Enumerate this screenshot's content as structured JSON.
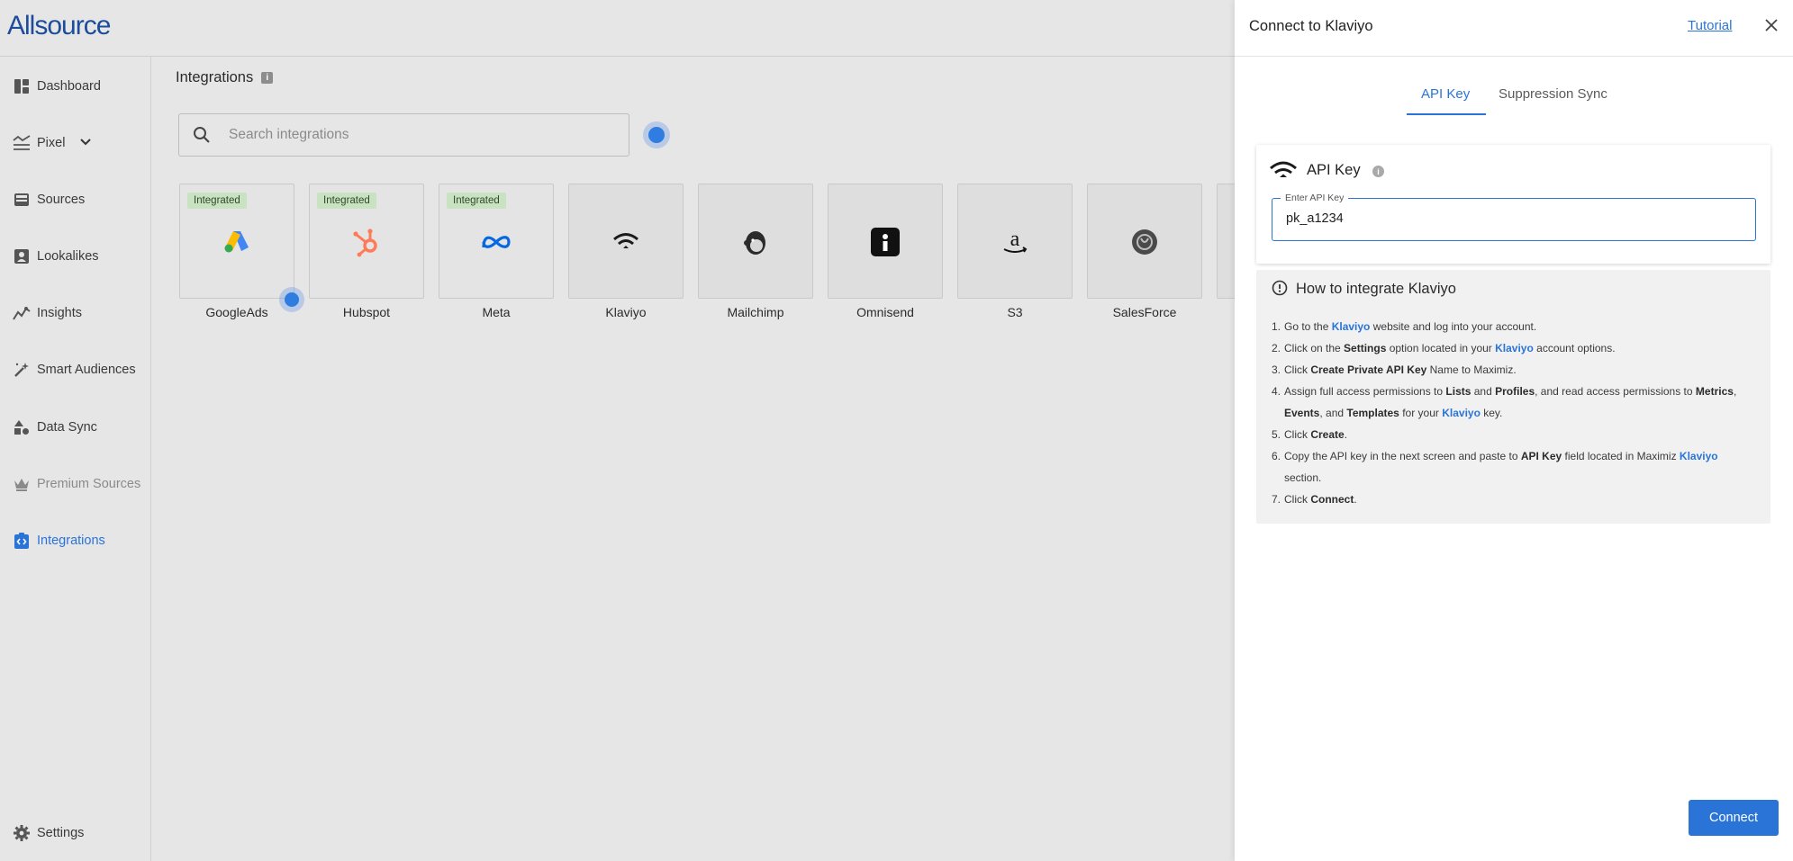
{
  "app": {
    "logo_text": "Allsource"
  },
  "sidebar": {
    "items": [
      {
        "label": "Dashboard",
        "icon": "dashboard-icon"
      },
      {
        "label": "Pixel",
        "icon": "pixel-icon"
      },
      {
        "label": "Sources",
        "icon": "sources-icon"
      },
      {
        "label": "Lookalikes",
        "icon": "lookalikes-icon"
      },
      {
        "label": "Insights",
        "icon": "insights-icon"
      },
      {
        "label": "Smart Audiences",
        "icon": "magic-wand-icon"
      },
      {
        "label": "Data Sync",
        "icon": "data-sync-icon"
      },
      {
        "label": "Premium Sources",
        "icon": "crown-icon"
      },
      {
        "label": "Integrations",
        "icon": "integrations-icon",
        "active": true
      },
      {
        "label": "Settings",
        "icon": "gear-icon"
      }
    ]
  },
  "main": {
    "title": "Integrations",
    "search_placeholder": "Search integrations",
    "integrations": [
      {
        "name": "GoogleAds",
        "badge": "Integrated"
      },
      {
        "name": "Hubspot",
        "badge": "Integrated"
      },
      {
        "name": "Meta",
        "badge": "Integrated"
      },
      {
        "name": "Klaviyo"
      },
      {
        "name": "Mailchimp"
      },
      {
        "name": "Omnisend"
      },
      {
        "name": "S3"
      },
      {
        "name": "SalesForce"
      }
    ]
  },
  "drawer": {
    "title": "Connect to Klaviyo",
    "tutorial_label": "Tutorial",
    "tabs": [
      "API Key",
      "Suppression Sync"
    ],
    "api_section_title": "API Key",
    "api_field_label": "Enter API Key",
    "api_field_value": "pk_a1234",
    "howto_title": "How to integrate Klaviyo",
    "steps": {
      "s1": {
        "n": "1.",
        "a": "Go to the ",
        "b": "Klaviyo",
        "c": " website and log into your account."
      },
      "s2": {
        "n": "2.",
        "a": "Click on the ",
        "b": "Settings",
        "c": " option located in your ",
        "d": "Klaviyo",
        "e": " account options."
      },
      "s3": {
        "n": "3.",
        "a": "Click ",
        "b": "Create Private API Key",
        "c": " Name to Maximiz."
      },
      "s4": {
        "n": "4.",
        "a": "Assign full access permissions to ",
        "b": "Lists",
        "c": " and ",
        "d": "Profiles",
        "e": ", and read access permissions to ",
        "f": "Metrics",
        "g": ",",
        "h": "Events",
        "i": ", and ",
        "j": "Templates",
        "k": " for your ",
        "l": "Klaviyo",
        "m": " key."
      },
      "s5": {
        "n": "5.",
        "a": "Click ",
        "b": "Create",
        "c": "."
      },
      "s6": {
        "n": "6.",
        "a": "Copy the API key in the next screen and paste to ",
        "b": "API Key",
        "c": " field located in Maximiz ",
        "d": "Klaviyo",
        "e": "section."
      },
      "s7": {
        "n": "7.",
        "a": "Click ",
        "b": "Connect",
        "c": "."
      }
    },
    "connect_label": "Connect"
  },
  "colors": {
    "accent": "#2a74d8",
    "integrated_badge": "#c9e2c1",
    "logo": "#1d4d9a"
  }
}
